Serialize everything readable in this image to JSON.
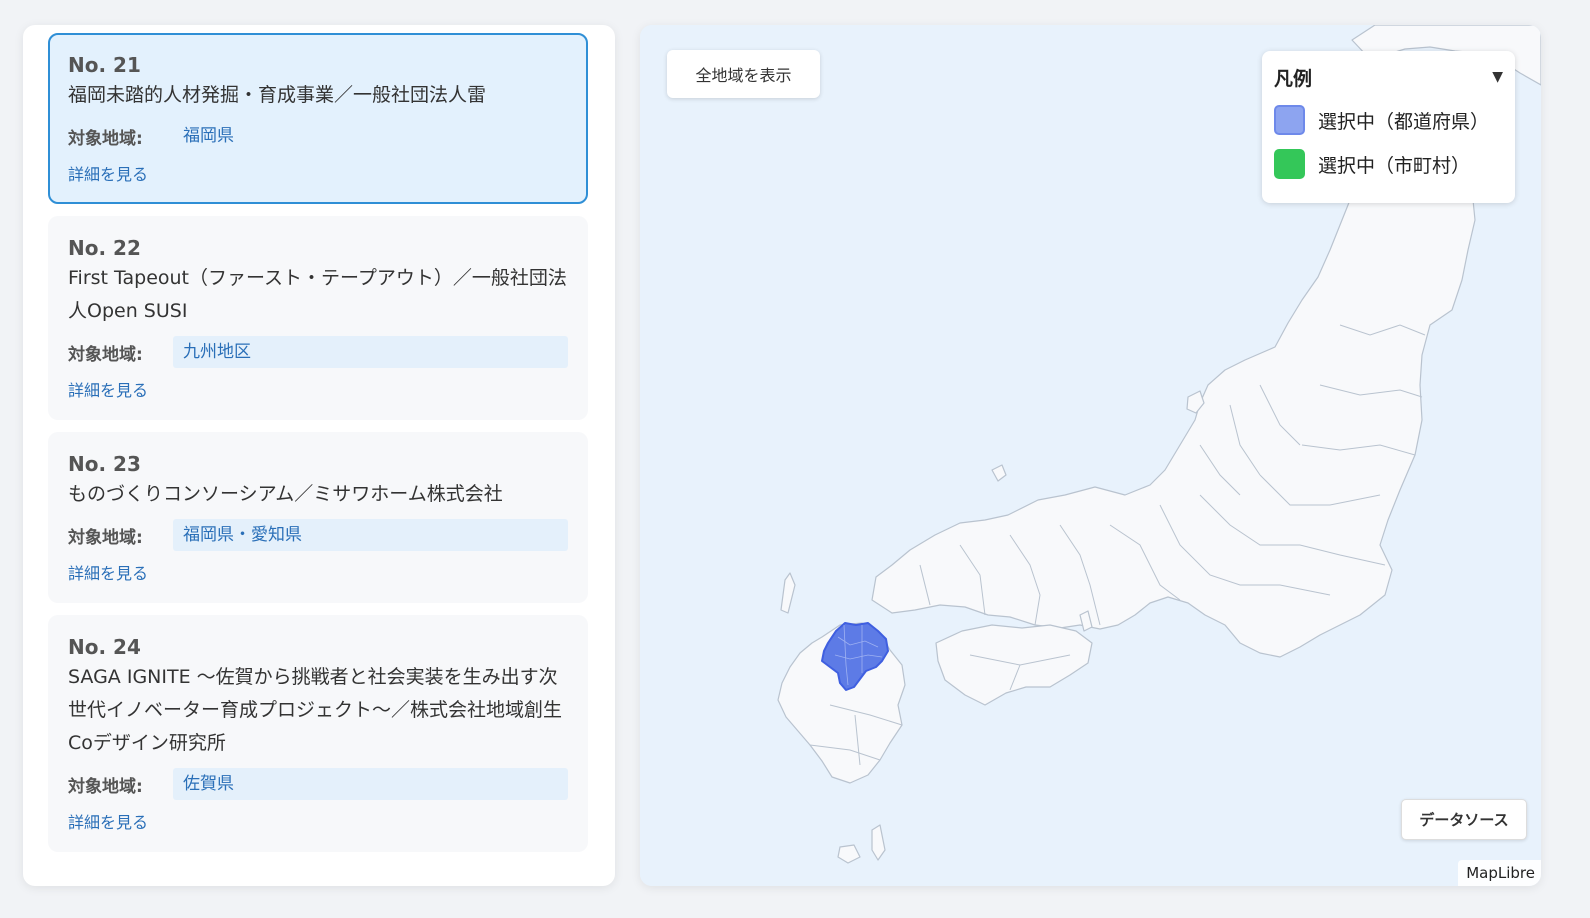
{
  "cards": [
    {
      "no": "No. 21",
      "title": "福岡未踏的人材発掘・育成事業／一般社団法人雷",
      "region_label": "対象地域:",
      "region": "福岡県",
      "detail": "詳細を見る"
    },
    {
      "no": "No. 22",
      "title": "First Tapeout（ファースト・テープアウト）／一般社団法人Open SUSI",
      "region_label": "対象地域:",
      "region": "九州地区",
      "detail": "詳細を見る"
    },
    {
      "no": "No. 23",
      "title": "ものづくりコンソーシアム／ミサワホーム株式会社",
      "region_label": "対象地域:",
      "region": "福岡県・愛知県",
      "detail": "詳細を見る"
    },
    {
      "no": "No. 24",
      "title": "SAGA IGNITE 〜佐賀から挑戦者と社会実装を生み出す次世代イノベーター育成プロジェクト〜／株式会社地域創生Coデザイン研究所",
      "region_label": "対象地域:",
      "region": "佐賀県",
      "detail": "詳細を見る"
    }
  ],
  "map": {
    "show_all_label": "全地域を表示",
    "legend": {
      "title": "凡例",
      "toggle": "▼",
      "items": [
        {
          "label": "選択中（都道府県）",
          "color": "#8da4f0"
        },
        {
          "label": "選択中（市町村）",
          "color": "#34c759"
        }
      ]
    },
    "data_source_label": "データソース",
    "attribution": "MapLibre",
    "colors": {
      "water": "#e8f2fc",
      "land": "#f8f9fb",
      "border": "#b9c3cf",
      "highlight": "#3f5fe0"
    }
  }
}
